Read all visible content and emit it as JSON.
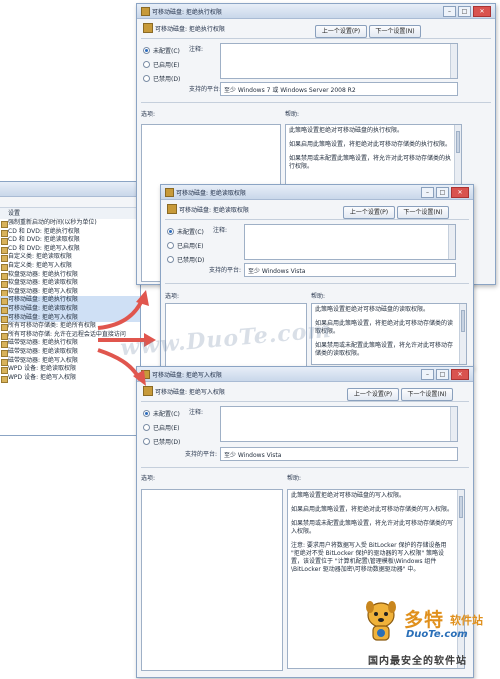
{
  "list_panel": {
    "column_header": "设置",
    "items": [
      "强制重新启动的时间(以秒为单位)",
      "CD 和 DVD: 拒绝执行权限",
      "CD 和 DVD: 拒绝读取权限",
      "CD 和 DVD: 拒绝写入权限",
      "自定义类: 拒绝读取权限",
      "自定义类: 拒绝写入权限",
      "软盘驱动器: 拒绝执行权限",
      "软盘驱动器: 拒绝读取权限",
      "软盘驱动器: 拒绝写入权限",
      "可移动磁盘: 拒绝执行权限",
      "可移动磁盘: 拒绝读取权限",
      "可移动磁盘: 拒绝写入权限",
      "所有可移动存储类: 拒绝所有权限",
      "所有可移动存储: 允许在远程会话中直接访问",
      "磁带驱动器: 拒绝执行权限",
      "磁带驱动器: 拒绝读取权限",
      "磁带驱动器: 拒绝写入权限",
      "WPD 设备: 拒绝读取权限",
      "WPD 设备: 拒绝写入权限"
    ]
  },
  "common": {
    "prev_button": "上一个设置(P)",
    "next_button": "下一个设置(N)",
    "radio_not_configured": "未配置(C)",
    "radio_enabled": "已启用(E)",
    "radio_disabled": "已禁用(D)",
    "comment_label": "注释:",
    "supported_label": "支持的平台:",
    "options_label": "选项:",
    "help_label": "帮助:"
  },
  "dialog_exec": {
    "title": "可移动磁盘: 拒绝执行权限",
    "heading": "可移动磁盘: 拒绝执行权限",
    "supported": "至少 Windows 7 或 Windows Server 2008 R2",
    "help": [
      "此策略设置拒绝对可移动磁盘的执行权限。",
      "如果启用此策略设置，将拒绝对此可移动存储类的执行权限。",
      "如果禁用或未配置此策略设置，将允许对此可移动存储类的执行权限。"
    ]
  },
  "dialog_read": {
    "title": "可移动磁盘: 拒绝读取权限",
    "heading": "可移动磁盘: 拒绝读取权限",
    "supported": "至少 Windows Vista",
    "help": [
      "此策略设置拒绝对可移动磁盘的读取权限。",
      "如果启用此策略设置，将拒绝对此可移动存储类的读取权限。",
      "如果禁用或未配置此策略设置，将允许对此可移动存储类的读取权限。"
    ]
  },
  "dialog_write": {
    "title": "可移动磁盘: 拒绝写入权限",
    "heading": "可移动磁盘: 拒绝写入权限",
    "supported": "至少 Windows Vista",
    "help": [
      "此策略设置拒绝对可移动磁盘的写入权限。",
      "如果启用此策略设置，将拒绝对此可移动存储类的写入权限。",
      "如果禁用或未配置此策略设置，将允许对此可移动存储类的写入权限。",
      "注意: 要求用户将数据写入受 BitLocker 保护的存储设备用 \"拒绝对不受 BitLocker 保护的驱动器的写入权限\" 策略设置，该设置位于 \"计算机配置\\管理模板\\Windows 组件\\BitLocker 驱动器加密\\可移动数据驱动器\" 中。"
    ]
  },
  "watermark": "www.DuoTe.com",
  "logo": {
    "main": "多特",
    "sub": "软件站",
    "url": "DuoTe.com",
    "tagline": "国内最安全的软件站"
  },
  "colors": {
    "arrow": "#e0564e",
    "accent": "#2e6dbf",
    "logo_orange": "#e0901c"
  }
}
